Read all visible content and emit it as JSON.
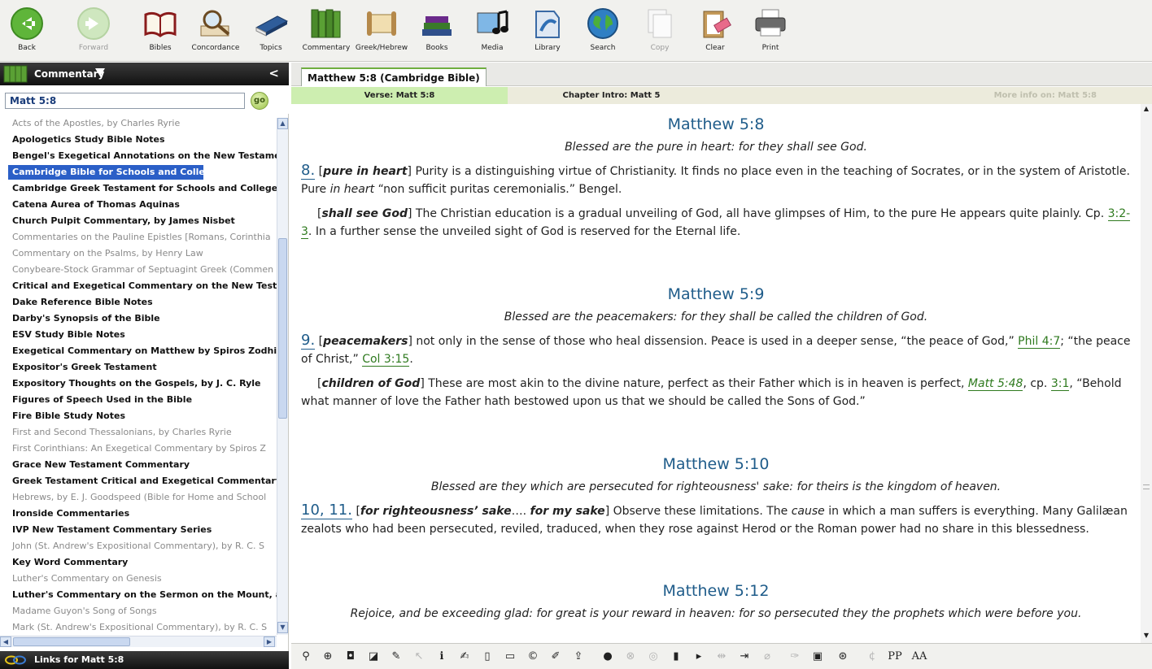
{
  "toolbar": {
    "back": "Back",
    "forward": "Forward",
    "bibles": "Bibles",
    "concordance": "Concordance",
    "topics": "Topics",
    "commentary": "Commentary",
    "greek_hebrew": "Greek/Hebrew",
    "books": "Books",
    "media": "Media",
    "library": "Library",
    "search": "Search",
    "copy": "Copy",
    "clear": "Clear",
    "print": "Print"
  },
  "left_panel": {
    "title": "Commentary",
    "collapse": "<",
    "search_value": "Matt 5:8",
    "go_label": "go",
    "books": [
      {
        "title": "Acts of the Apostles, by Charles Ryrie",
        "owned": false
      },
      {
        "title": "Apologetics Study Bible Notes",
        "owned": true
      },
      {
        "title": "Bengel's Exegetical Annotations on the New Testament (",
        "owned": true
      },
      {
        "title": "Cambridge Bible for Schools and Colleges",
        "owned": true,
        "selected": true
      },
      {
        "title": "Cambridge Greek Testament for Schools and Colleges",
        "owned": true
      },
      {
        "title": "Catena Aurea of Thomas Aquinas",
        "owned": true
      },
      {
        "title": "Church Pulpit Commentary, by James Nisbet",
        "owned": true
      },
      {
        "title": "Commentaries on the Pauline Epistles [Romans, Corinthia",
        "owned": false
      },
      {
        "title": "Commentary on the Psalms, by Henry Law",
        "owned": false
      },
      {
        "title": "Conybeare-Stock Grammar of Septuagint Greek (Commen",
        "owned": false
      },
      {
        "title": "Critical and Exegetical Commentary on the New Testame",
        "owned": true
      },
      {
        "title": "Dake Reference Bible Notes",
        "owned": true
      },
      {
        "title": "Darby's Synopsis of the Bible",
        "owned": true
      },
      {
        "title": "ESV Study Bible Notes",
        "owned": true
      },
      {
        "title": "Exegetical Commentary on Matthew by Spiros Zodhiates",
        "owned": true
      },
      {
        "title": "Expositor's Greek Testament",
        "owned": true
      },
      {
        "title": "Expository Thoughts on the Gospels, by J. C. Ryle",
        "owned": true
      },
      {
        "title": "Figures of Speech Used in the Bible",
        "owned": true
      },
      {
        "title": "Fire Bible Study Notes",
        "owned": true
      },
      {
        "title": "First and Second Thessalonians, by Charles Ryrie",
        "owned": false
      },
      {
        "title": "First Corinthians: An Exegetical Commentary by Spiros Z",
        "owned": false
      },
      {
        "title": "Grace New Testament Commentary",
        "owned": true
      },
      {
        "title": "Greek Testament Critical and Exegetical Commentary, by",
        "owned": true
      },
      {
        "title": "Hebrews, by E. J. Goodspeed (Bible for Home and School",
        "owned": false
      },
      {
        "title": "Ironside Commentaries",
        "owned": true
      },
      {
        "title": "IVP New Testament Commentary Series",
        "owned": true
      },
      {
        "title": "John (St. Andrew's Expositional Commentary), by R. C. S",
        "owned": false
      },
      {
        "title": "Key Word Commentary",
        "owned": true
      },
      {
        "title": "Luther's Commentary on Genesis",
        "owned": false
      },
      {
        "title": "Luther's Commentary on the Sermon on the Mount, and (",
        "owned": true
      },
      {
        "title": "Madame Guyon's Song of Songs",
        "owned": false
      },
      {
        "title": "Mark (St. Andrew's Expositional Commentary), by R. C. S",
        "owned": false
      }
    ],
    "links_label": "Links for Matt 5:8"
  },
  "right_panel": {
    "tab_label": "Matthew 5:8 (Cambridge Bible)",
    "subtab_verse": "Verse: Matt 5:8",
    "subtab_chapter": "Chapter Intro: Matt 5",
    "subtab_more": "More info on: Matt 5:8",
    "sections": {
      "s1": {
        "title": "Matthew 5:8",
        "verse": "Blessed are the pure in heart: for they shall see God.",
        "n1_num": "8.",
        "n1_term": "pure in heart",
        "n1_a": " Purity is a distinguishing virtue of Christianity. It finds no place even in the teaching of Socrates, or in the system of Aristotle. Pure ",
        "n1_it": "in heart",
        "n1_b": " “non sufficit puritas ceremonialis.” Bengel.",
        "n2_term": "shall see God",
        "n2_a": " The Christian education is a gradual unveiling of God, all have glimpses of Him, to the pure He appears quite plainly. Cp. ",
        "n2_ref": "3:2-3",
        "n2_b": ". In a further sense the unveiled sight of God is reserved for the Eternal life."
      },
      "s2": {
        "title": "Matthew 5:9",
        "verse": "Blessed are the peacemakers: for they shall be called the children of God.",
        "n1_num": "9.",
        "n1_term": "peacemakers",
        "n1_a": " not only in the sense of those who heal dissension. Peace is used in a deeper sense, “the peace of God,” ",
        "n1_ref1": "Phil 4:7",
        "n1_b": "; “the peace of Christ,” ",
        "n1_ref2": "Col 3:15",
        "n1_c": ".",
        "n2_term": "children of God",
        "n2_a": " These are most akin to the divine nature, perfect as their Father which is in heaven is perfect, ",
        "n2_ref1": "Matt 5:48",
        "n2_b": ", cp. ",
        "n2_ref2": "3:1",
        "n2_c": ", “Behold what manner of love the Father hath bestowed upon us that we should be called the Sons of God.”"
      },
      "s3": {
        "title": "Matthew 5:10",
        "verse": "Blessed are they which are persecuted for righteousness' sake: for theirs is the kingdom of heaven.",
        "n1_num": "10, 11.",
        "n1_term": "for righteousness’ sake",
        "n1_dots": "….",
        "n1_term2": "for my sake",
        "n1_a": " Observe these limitations. The ",
        "n1_it": "cause",
        "n1_b": " in which a man suffers is everything. Many Galilæan zealots who had been persecuted, reviled, traduced, when they rose against Herod or the Roman power had no share in this blessedness."
      },
      "s4": {
        "title": "Matthew 5:12",
        "verse": "Rejoice, and be exceeding glad: for great is your reward in heaven: for so persecuted they the prophets which were before you."
      }
    }
  },
  "brackets": {
    "open": "[",
    "close": "]"
  },
  "bottom_tools": {
    "pp": "PP",
    "aa": "AA"
  },
  "colors": {
    "title_blue": "#1f5c8a",
    "link_green": "#2f7a1f",
    "selection_blue": "#2b5fc7"
  }
}
